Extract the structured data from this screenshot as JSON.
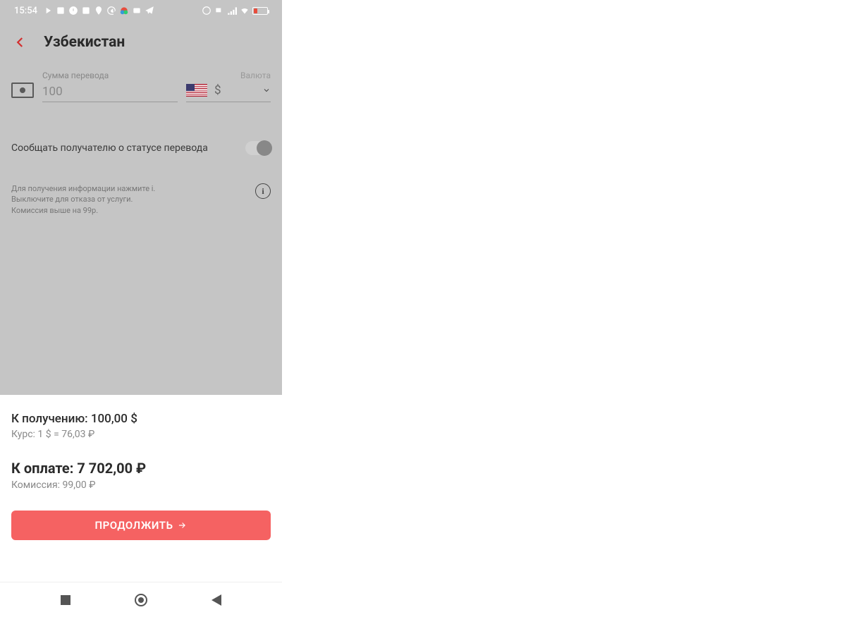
{
  "status": {
    "time": "15:54"
  },
  "header": {
    "title": "Узбекистан"
  },
  "form": {
    "amount_label": "Сумма перевода",
    "amount_value": "100",
    "currency_label": "Валюта",
    "currency_symbol": "$"
  },
  "toggle": {
    "label": "Сообщать получателю о статусе перевода"
  },
  "info": {
    "line1": "Для получения информации нажмите i.",
    "line2": "Выключите для отказа от услуги.",
    "line3": "Комиссия выше на 99р."
  },
  "summary": {
    "receive_label": "К получению: 100,00 $",
    "rate_label": "Курс: 1 $ = 76,03 ₽",
    "pay_label": "К оплате: 7 702,00 ₽",
    "fee_label": "Комиссия: 99,00 ₽"
  },
  "buttons": {
    "continue": "ПРОДОЛЖИТЬ"
  }
}
